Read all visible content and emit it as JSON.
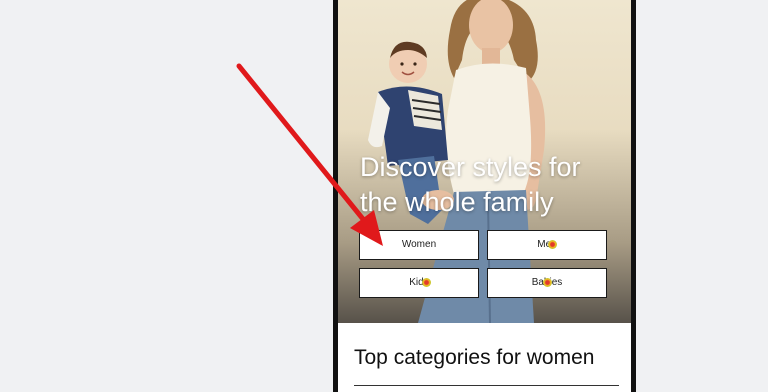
{
  "hero": {
    "title": "Discover styles for the whole family",
    "buttons": {
      "women": "Women",
      "men": "Men",
      "kids": "Kids",
      "babies": "Babies"
    }
  },
  "section": {
    "title": "Top categories for women"
  },
  "colors": {
    "annotation_arrow": "#e0191b",
    "button_border": "#1a1a1a",
    "page_background": "#f0f1f3"
  }
}
